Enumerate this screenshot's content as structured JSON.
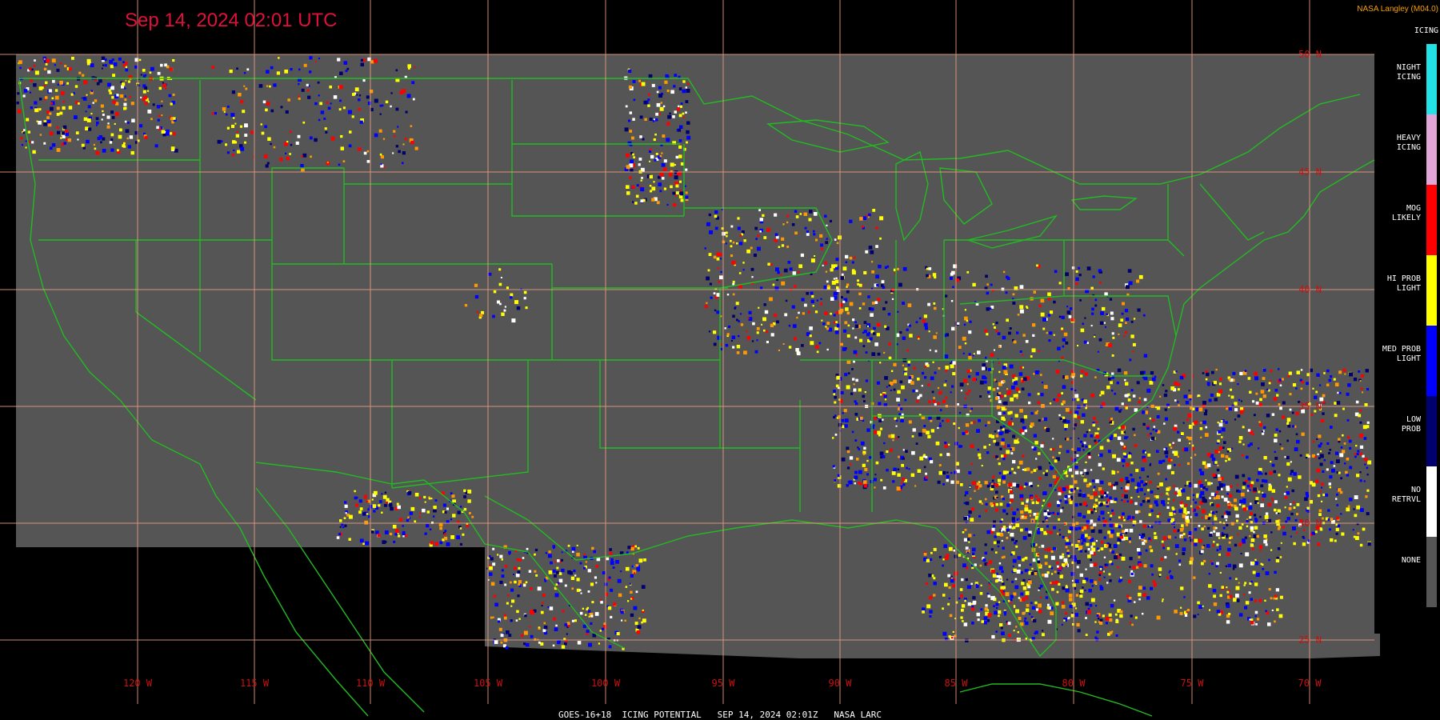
{
  "header": {
    "timestamp": "Sep 14, 2024 02:01 UTC",
    "brand": "NASA Langley (M04.0)"
  },
  "colors": {
    "timestamp": "#e0103a",
    "brand": "#f5a000",
    "background": "#000000",
    "map_fill": "#555555",
    "gridline": "#f0a080",
    "coastline": "#22bb22",
    "tick_label": "#cc1111"
  },
  "legend": {
    "title": "ICING",
    "items": [
      {
        "label": "NIGHT\nICING",
        "color": "#22e2e6"
      },
      {
        "label": "HEAVY\nICING",
        "color": "#e1a6d8"
      },
      {
        "label": "MOG\nLIKELY",
        "color": "#ff0000"
      },
      {
        "label": "HI PROB\nLIGHT",
        "color": "#ffff00"
      },
      {
        "label": "MED PROB\nLIGHT",
        "color": "#0000ff"
      },
      {
        "label": "LOW\nPROB",
        "color": "#00006e"
      },
      {
        "label": "NO\nRETRVL",
        "color": "#ffffff"
      },
      {
        "label": "NONE",
        "color": "#555555"
      }
    ]
  },
  "map": {
    "longitude_labels": [
      "120 W",
      "115 W",
      "110 W",
      "105 W",
      "100 W",
      "95 W",
      "90 W",
      "85 W",
      "80 W",
      "75 W",
      "70 W"
    ],
    "latitude_labels": [
      "50 N",
      "45 N",
      "40 N",
      "35 N",
      "30 N",
      "25 N"
    ]
  },
  "footer": {
    "caption": "GOES-16+18  ICING POTENTIAL   SEP 14, 2024 02:01Z   NASA LARC"
  }
}
